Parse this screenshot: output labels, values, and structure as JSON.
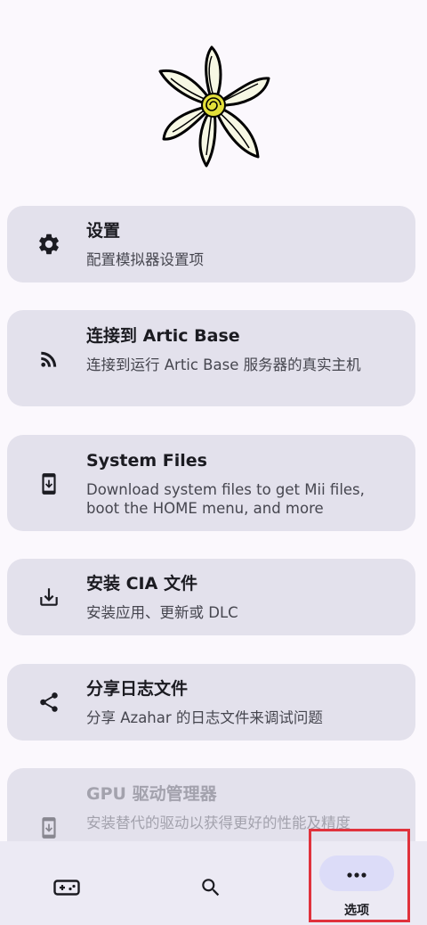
{
  "cards": [
    {
      "icon": "gear-icon",
      "title": "设置",
      "desc": "配置模拟器设置项"
    },
    {
      "icon": "rss-icon",
      "title": "连接到 Artic Base",
      "desc": "连接到运行 Artic Base 服务器的真实主机"
    },
    {
      "icon": "phone-download-icon",
      "title": "System Files",
      "desc": "Download system files to get Mii files, boot the HOME menu, and more"
    },
    {
      "icon": "download-tray-icon",
      "title": "安装 CIA 文件",
      "desc": "安装应用、更新或 DLC"
    },
    {
      "icon": "share-icon",
      "title": "分享日志文件",
      "desc": "分享 Azahar 的日志文件来调试问题"
    },
    {
      "icon": "driver-icon",
      "title": "GPU 驱动管理器",
      "desc": "安装替代的驱动以获得更好的性能及精度"
    }
  ],
  "nav": {
    "games_icon": "gamepad-icon",
    "search_icon": "search-icon",
    "options_icon": "more-horizontal-icon",
    "options_label": "选项"
  },
  "colors": {
    "background": "#fbf8fd",
    "card": "#e3e1ec",
    "nav_bar": "#eceaf4",
    "active_pill": "#dcdcf8",
    "highlight": "#e0323c"
  }
}
